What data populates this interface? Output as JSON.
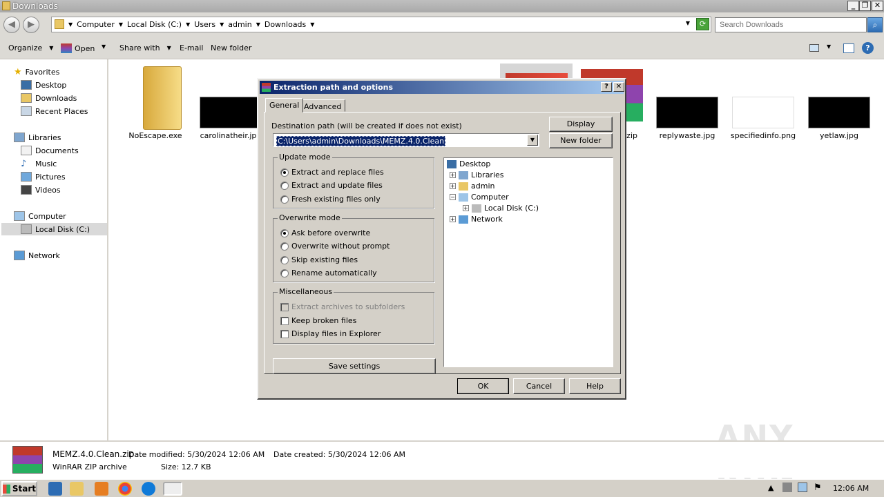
{
  "window": {
    "title": "Downloads"
  },
  "address": {
    "crumbs": [
      "Computer",
      "Local Disk (C:)",
      "Users",
      "admin",
      "Downloads"
    ],
    "search_placeholder": "Search Downloads"
  },
  "toolbar": {
    "organize": "Organize",
    "open": "Open",
    "share_with": "Share with",
    "email": "E-mail",
    "new_folder": "New folder"
  },
  "nav": {
    "favorites": "Favorites",
    "desktop": "Desktop",
    "downloads": "Downloads",
    "recent_places": "Recent Places",
    "libraries": "Libraries",
    "documents": "Documents",
    "music": "Music",
    "pictures": "Pictures",
    "videos": "Videos",
    "computer": "Computer",
    "local_disk": "Local Disk (C:)",
    "network": "Network"
  },
  "files": [
    {
      "name": "NoEscape.exe"
    },
    {
      "name": "carolinatheir.jpg"
    },
    {
      "name": "e.zip"
    },
    {
      "name": "replywaste.jpg"
    },
    {
      "name": "specifiedinfo.png"
    },
    {
      "name": "yetlaw.jpg"
    }
  ],
  "details": {
    "filename": "MEMZ.4.0.Clean.zip",
    "modified": "Date modified: 5/30/2024 12:06 AM",
    "created": "Date created: 5/30/2024 12:06 AM",
    "type": "WinRAR ZIP archive",
    "size": "Size: 12.7 KB"
  },
  "dialog": {
    "title": "Extraction path and options",
    "help_glyph": "?",
    "close_glyph": "✕",
    "tabs": {
      "general": "General",
      "advanced": "Advanced"
    },
    "dest_label": "Destination path (will be created if does not exist)",
    "dest_value": "C:\\Users\\admin\\Downloads\\MEMZ.4.0.Clean",
    "display_button": "Display",
    "new_folder_button": "New folder",
    "update_mode": {
      "label": "Update mode",
      "options": [
        "Extract and replace files",
        "Extract and update files",
        "Fresh existing files only"
      ]
    },
    "overwrite_mode": {
      "label": "Overwrite mode",
      "options": [
        "Ask before overwrite",
        "Overwrite without prompt",
        "Skip existing files",
        "Rename automatically"
      ]
    },
    "misc": {
      "label": "Miscellaneous",
      "options": [
        "Extract archives to subfolders",
        "Keep broken files",
        "Display files in Explorer"
      ]
    },
    "save_settings": "Save settings",
    "tree": [
      "Desktop",
      "Libraries",
      "admin",
      "Computer",
      "Local Disk (C:)",
      "Network"
    ],
    "ok": "OK",
    "cancel": "Cancel",
    "help": "Help"
  },
  "taskbar": {
    "start": "Start",
    "clock": "12:06 AM"
  },
  "watermark": "ANY RUN",
  "colors": {
    "dialog_title_start": "#0a246a",
    "dialog_title_end": "#a6caf0",
    "selection": "#0a246a"
  }
}
